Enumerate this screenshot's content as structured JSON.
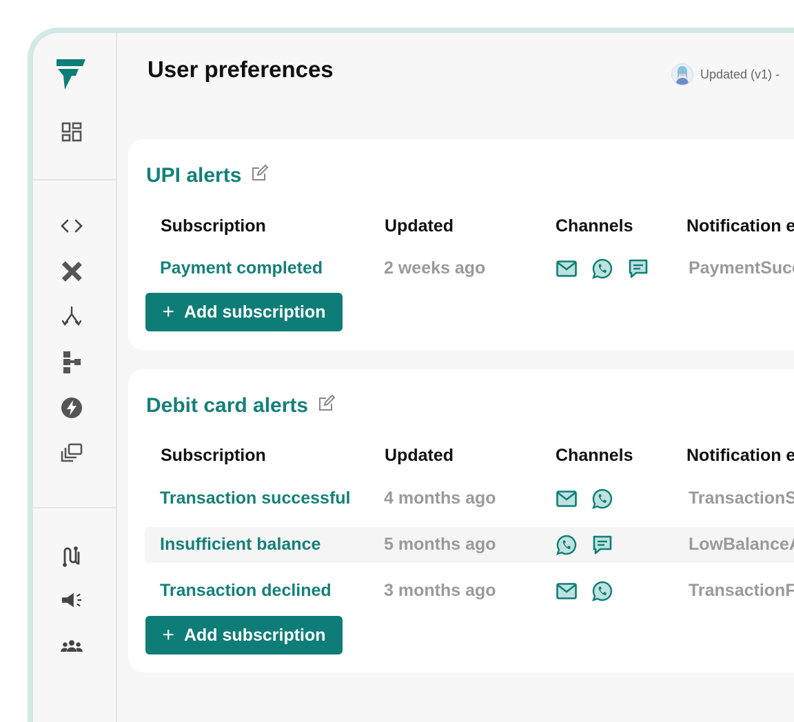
{
  "header": {
    "title": "User preferences",
    "status": "Updated (v1) -"
  },
  "table_headers": {
    "subscription": "Subscription",
    "updated": "Updated",
    "channels": "Channels",
    "event": "Notification e"
  },
  "sections": [
    {
      "title": "UPI alerts",
      "add_label": "Add subscription",
      "rows": [
        {
          "name": "Payment completed",
          "updated": "2 weeks ago",
          "channels": [
            "email-icon",
            "whatsapp-icon",
            "sms-icon"
          ],
          "event": "PaymentSucc"
        }
      ]
    },
    {
      "title": "Debit card alerts",
      "add_label": "Add subscription",
      "rows": [
        {
          "name": "Transaction successful",
          "updated": "4 months ago",
          "channels": [
            "email-icon",
            "whatsapp-icon"
          ],
          "event": "TransactionS"
        },
        {
          "name": "Insufficient balance",
          "updated": "5 months ago",
          "channels": [
            "whatsapp-icon",
            "sms-icon"
          ],
          "event": "LowBalanceA"
        },
        {
          "name": "Transaction declined",
          "updated": "3 months ago",
          "channels": [
            "email-icon",
            "whatsapp-icon"
          ],
          "event": "TransactionF"
        }
      ]
    }
  ],
  "sidebar": {
    "icons": [
      "dashboard-icon",
      "code-icon",
      "design-tools-icon",
      "fork-icon",
      "workflow-icon",
      "lightning-icon",
      "templates-icon",
      "integrations-icon",
      "megaphone-icon",
      "team-icon"
    ]
  },
  "colors": {
    "accent": "#0e7d77",
    "accent_text": "#15807a",
    "muted": "#9a9a9a",
    "frame": "#d2e9e6"
  }
}
